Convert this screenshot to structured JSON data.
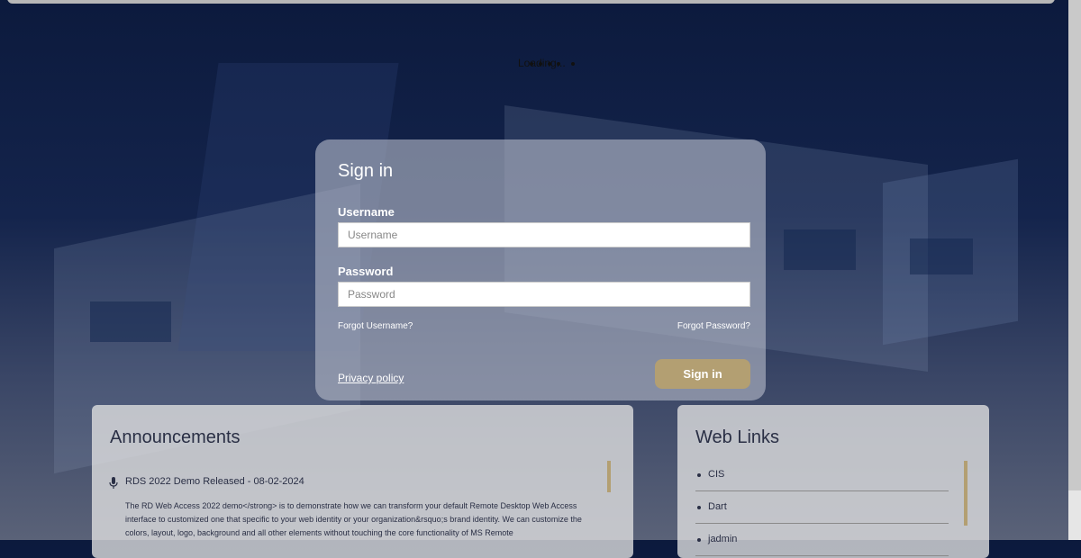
{
  "loading_text": "Loading...",
  "login": {
    "title": "Sign in",
    "username_label": "Username",
    "username_placeholder": "Username",
    "password_label": "Password",
    "password_placeholder": "Password",
    "forgot_username": "Forgot Username?",
    "forgot_password": "Forgot Password?",
    "privacy_policy": "Privacy policy",
    "signin_button": "Sign in"
  },
  "announcements": {
    "title": "Announcements",
    "items": [
      {
        "icon": "microphone-icon",
        "title": "RDS 2022 Demo Released - 08-02-2024",
        "body": "The RD Web Access 2022 demo</strong> is to demonstrate how we can transform your default Remote Desktop Web Access interface to customized one that specific to your web identity or your organization&rsquo;s brand identity. We can customize the colors, layout, logo, background and all other elements without touching the core functionality of MS Remote"
      }
    ]
  },
  "web_links": {
    "title": "Web Links",
    "items": [
      "CIS",
      "Dart",
      "jadmin"
    ]
  },
  "colors": {
    "accent": "#b39f72",
    "background_dark": "#0c1a3d"
  }
}
